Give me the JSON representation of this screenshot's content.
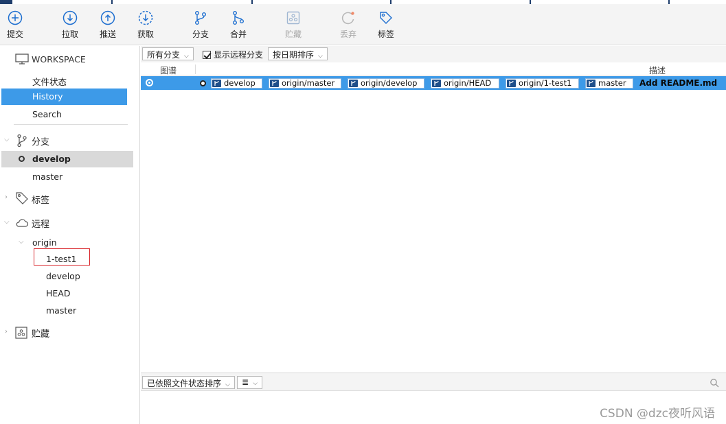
{
  "toolbar": {
    "commit": "提交",
    "pull": "拉取",
    "push": "推送",
    "fetch": "获取",
    "branch": "分支",
    "merge": "合并",
    "stash": "贮藏",
    "discard": "丢弃",
    "tag": "标签"
  },
  "sidebar": {
    "workspace": "WORKSPACE",
    "file_status": "文件状态",
    "history": "History",
    "search": "Search",
    "branches_header": "分支",
    "branches": [
      "develop",
      "master"
    ],
    "tags_header": "标签",
    "remotes_header": "远程",
    "remote_name": "origin",
    "remote_branches": [
      "1-test1",
      "develop",
      "HEAD",
      "master"
    ],
    "stashes_header": "贮藏"
  },
  "filter": {
    "branch_filter": "所有分支",
    "show_remote": "显示远程分支",
    "sort": "按日期排序"
  },
  "columns": {
    "graph": "图谱",
    "description": "描述"
  },
  "commit": {
    "refs": [
      "develop",
      "origin/master",
      "origin/develop",
      "origin/HEAD",
      "origin/1-test1",
      "master"
    ],
    "message": "Add README.md"
  },
  "bottom": {
    "sort_mode": "已依照文件状态排序",
    "view_mode": "≣"
  },
  "watermark": "CSDN @dzc夜听风语",
  "colors": {
    "selection": "#3d9ae8",
    "accent": "#1e6fd0",
    "highlight_box": "#d9262b"
  }
}
